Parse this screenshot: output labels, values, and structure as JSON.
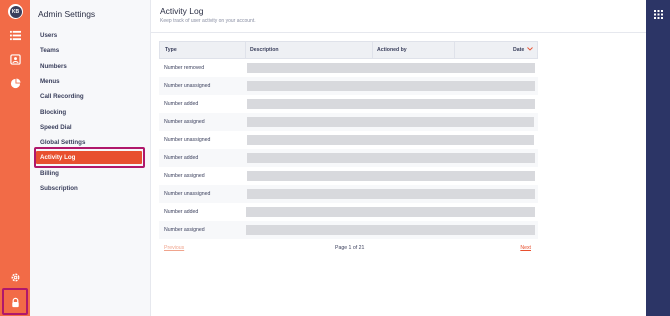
{
  "rail": {
    "avatar_initials": "KB",
    "icons": [
      "list-icon",
      "contact-card-icon",
      "pie-chart-icon",
      "gear-icon",
      "lock-icon"
    ]
  },
  "nav": {
    "title": "Admin Settings",
    "items": [
      {
        "label": "Users"
      },
      {
        "label": "Teams"
      },
      {
        "label": "Numbers"
      },
      {
        "label": "Menus"
      },
      {
        "label": "Call Recording"
      },
      {
        "label": "Blocking"
      },
      {
        "label": "Speed Dial"
      },
      {
        "label": "Global Settings"
      },
      {
        "label": "Activity Log",
        "active": true
      },
      {
        "label": "Billing"
      },
      {
        "label": "Subscription"
      }
    ]
  },
  "header": {
    "title": "Activity Log",
    "subtitle": "Keep track of user activity on your account."
  },
  "table": {
    "columns": [
      "Type",
      "Description",
      "Actioned by",
      "Date"
    ],
    "rows": [
      {
        "type": "Number removed"
      },
      {
        "type": "Number unassigned"
      },
      {
        "type": "Number added"
      },
      {
        "type": "Number assigned"
      },
      {
        "type": "Number unassigned"
      },
      {
        "type": "Number added"
      },
      {
        "type": "Number assigned"
      },
      {
        "type": "Number unassigned"
      },
      {
        "type": "Number added"
      },
      {
        "type": "Number assigned"
      }
    ]
  },
  "pager": {
    "previous": "Previous",
    "page_info": "Page 1 of 21",
    "next": "Next"
  },
  "colors": {
    "rail": "#f26b47",
    "accent": "#e8502f",
    "highlight_box": "#b0186b",
    "right_rail": "#2c3566"
  }
}
